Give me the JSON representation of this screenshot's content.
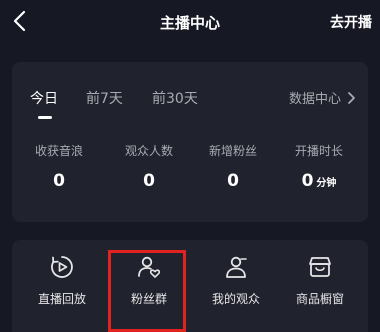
{
  "nav": {
    "title": "主播中心",
    "go_live_label": "去开播",
    "back_icon": "chevron-left-icon"
  },
  "stats": {
    "tabs": [
      {
        "label": "今日",
        "active": true
      },
      {
        "label": "前7天",
        "active": false
      },
      {
        "label": "前30天",
        "active": false
      }
    ],
    "data_center_label": "数据中心",
    "items": [
      {
        "label": "收获音浪",
        "value": "0",
        "unit": ""
      },
      {
        "label": "观众人数",
        "value": "0",
        "unit": ""
      },
      {
        "label": "新增粉丝",
        "value": "0",
        "unit": ""
      },
      {
        "label": "开播时长",
        "value": "0",
        "unit": "分钟"
      }
    ]
  },
  "functions": {
    "items": [
      {
        "label": "直播回放",
        "icon": "replay-icon"
      },
      {
        "label": "粉丝群",
        "icon": "fan-group-icon",
        "highlighted": true
      },
      {
        "label": "我的观众",
        "icon": "audience-icon"
      },
      {
        "label": "商品橱窗",
        "icon": "shop-window-icon"
      }
    ]
  },
  "colors": {
    "background": "#161823",
    "card": "#20222d",
    "highlight": "#e2221f"
  }
}
